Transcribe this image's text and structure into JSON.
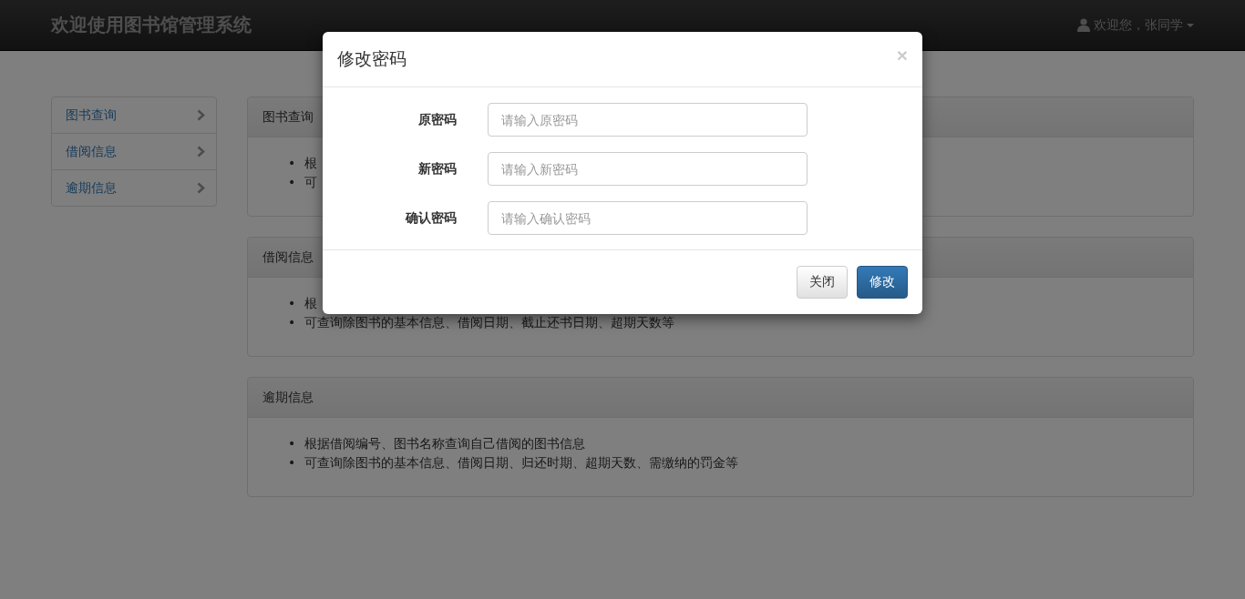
{
  "navbar": {
    "brand": "欢迎使用图书馆管理系统",
    "user_menu": "欢迎您，张同学"
  },
  "sidebar": {
    "items": [
      {
        "label": "图书查询"
      },
      {
        "label": "借阅信息"
      },
      {
        "label": "逾期信息"
      }
    ]
  },
  "panels": [
    {
      "title": "图书查询",
      "items": [
        {
          "marker": "•",
          "text": "根"
        },
        {
          "marker": "•",
          "text": "可"
        }
      ]
    },
    {
      "title": "借阅信息",
      "items": [
        {
          "marker": "•",
          "text": "根"
        },
        {
          "marker": "•",
          "text": "可查询除图书的基本信息、借阅日期、截止还书日期、超期天数等"
        }
      ]
    },
    {
      "title": "逾期信息",
      "items": [
        {
          "marker": "•",
          "text": "根据借阅编号、图书名称查询自己借阅的图书信息"
        },
        {
          "marker": "•",
          "text": "可查询除图书的基本信息、借阅日期、归还时期、超期天数、需缴纳的罚金等"
        }
      ]
    }
  ],
  "modal": {
    "title": "修改密码",
    "close": "×",
    "fields": [
      {
        "label": "原密码",
        "placeholder": "请输入原密码"
      },
      {
        "label": "新密码",
        "placeholder": "请输入新密码"
      },
      {
        "label": "确认密码",
        "placeholder": "请输入确认密码"
      }
    ],
    "buttons": [
      {
        "label": "关闭",
        "kind": "default"
      },
      {
        "label": "修改",
        "kind": "primary"
      }
    ]
  }
}
